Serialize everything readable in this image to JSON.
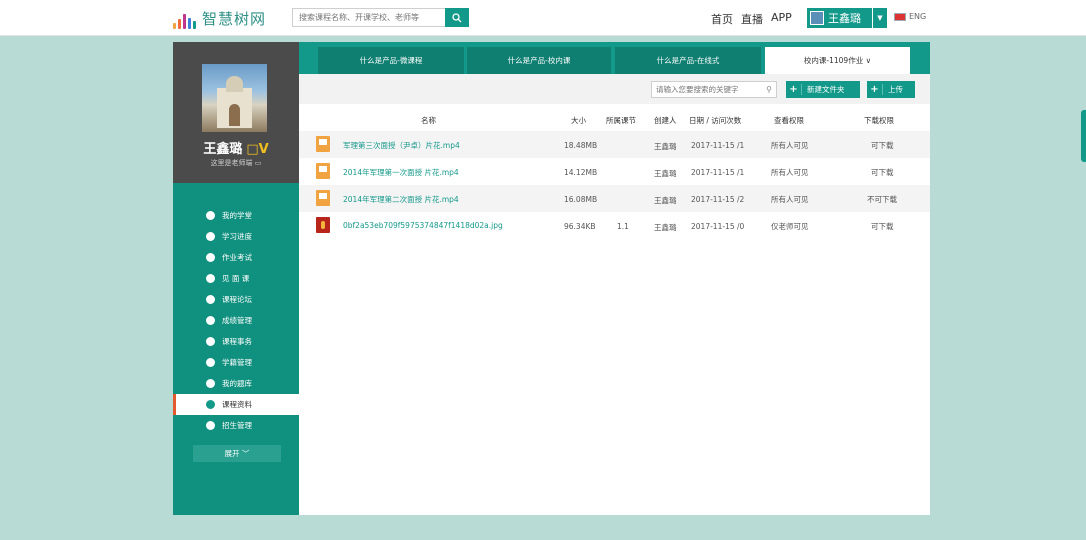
{
  "header": {
    "logo_text": "智慧树网",
    "logo_bar_colors": [
      "#f0a340",
      "#f06a3c",
      "#c0368c",
      "#3c7ed9",
      "#13998a",
      "#7cc24a"
    ],
    "search_placeholder": "搜索课程名称、开课学校、老师等",
    "nav": [
      "首页",
      "直播",
      "APP"
    ],
    "user_name": "王鑫璐",
    "lang_label": "ENG"
  },
  "sidebar": {
    "name": "王鑫璐",
    "badge": "V",
    "subtitle": "这里是老师端",
    "menu": [
      {
        "label": "我的学堂",
        "icon": "home-icon"
      },
      {
        "label": "学习进度",
        "icon": "progress-icon"
      },
      {
        "label": "作业考试",
        "icon": "pen-icon"
      },
      {
        "label": "见 面 课",
        "icon": "meeting-icon"
      },
      {
        "label": "课程论坛",
        "icon": "forum-icon"
      },
      {
        "label": "成绩管理",
        "icon": "check-icon"
      },
      {
        "label": "课程事务",
        "icon": "affairs-icon"
      },
      {
        "label": "学籍管理",
        "icon": "circle-icon"
      },
      {
        "label": "我的题库",
        "icon": "question-bank-icon"
      },
      {
        "label": "课程资料",
        "icon": "material-icon"
      },
      {
        "label": "招生管理",
        "icon": "enroll-icon"
      }
    ],
    "active_index": 9,
    "expand_label": "展开 ﹀"
  },
  "tabs": [
    {
      "label": "什么是产品-微课程"
    },
    {
      "label": "什么是产品-校内课"
    },
    {
      "label": "什么是产品-在线式"
    },
    {
      "label": "校内课-1109作业 ∨"
    }
  ],
  "toolbar": {
    "keyword_placeholder": "请输入您要搜索的关键字",
    "new_folder_label": "新建文件夹",
    "upload_label": "上传"
  },
  "table": {
    "headers": [
      "名称",
      "大小",
      "所属课节",
      "创建人",
      "日期 / 访问次数",
      "查看权限",
      "下载权限"
    ],
    "rows": [
      {
        "name": "军理第三次面授（尹卓）片花.mp4",
        "size": "18.48MB",
        "lesson": "",
        "creator": "王鑫璐",
        "date": "2017-11-15 /1",
        "view": "所有人可见",
        "download": "可下载",
        "type": "video"
      },
      {
        "name": "2014年军理第一次面授 片花.mp4",
        "size": "14.12MB",
        "lesson": "",
        "creator": "王鑫璐",
        "date": "2017-11-15 /1",
        "view": "所有人可见",
        "download": "可下载",
        "type": "video"
      },
      {
        "name": "2014年军理第二次面授 片花.mp4",
        "size": "16.08MB",
        "lesson": "",
        "creator": "王鑫璐",
        "date": "2017-11-15 /2",
        "view": "所有人可见",
        "download": "不可下载",
        "type": "video"
      },
      {
        "name": "0bf2a53eb709f5975374847f1418d02a.jpg",
        "size": "96.34KB",
        "lesson": "1.1",
        "creator": "王鑫璐",
        "date": "2017-11-15 /0",
        "view": "仅老师可见",
        "download": "可下载",
        "type": "image"
      }
    ]
  },
  "colors": {
    "primary": "#13998a",
    "sidebar_dark": "#4b4b4b",
    "background": "#b7d9d3"
  }
}
